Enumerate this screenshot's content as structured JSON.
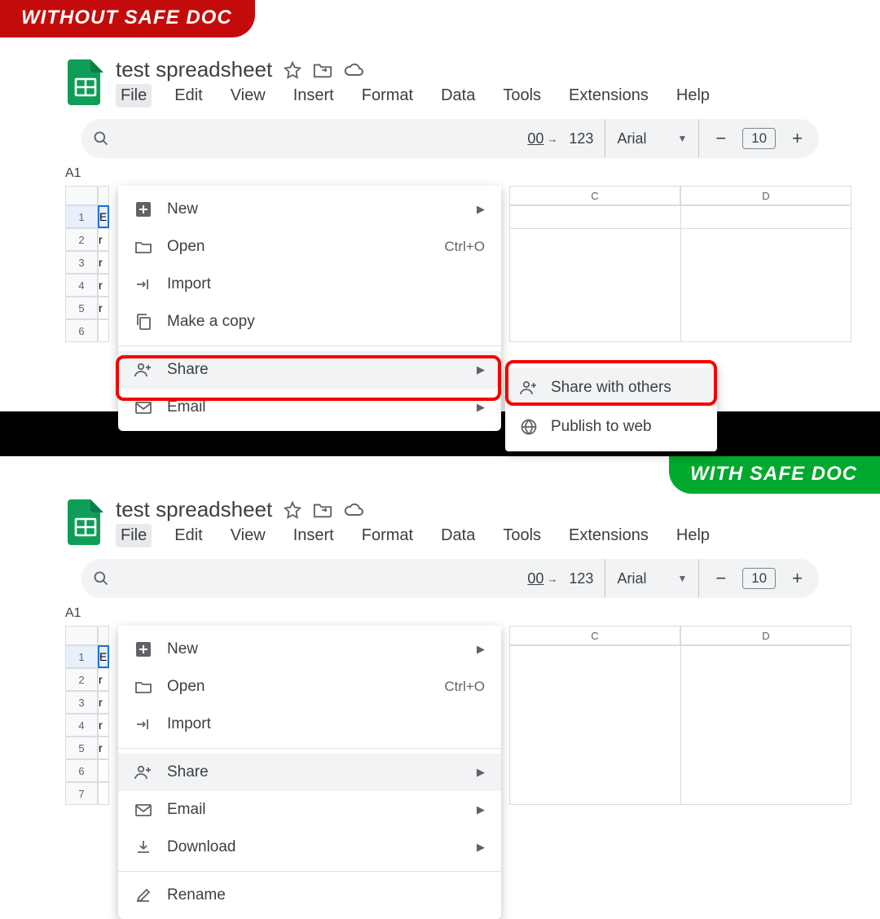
{
  "badges": {
    "without": "WITHOUT SAFE DOC",
    "with": "WITH SAFE DOC"
  },
  "doc": {
    "title": "test spreadsheet"
  },
  "menubar": [
    "File",
    "Edit",
    "View",
    "Insert",
    "Format",
    "Data",
    "Tools",
    "Extensions",
    "Help"
  ],
  "toolbar": {
    "zero_inc": "00",
    "num_fmt": "123",
    "font": "Arial",
    "size": "10"
  },
  "cell_ref": "A1",
  "cols": {
    "c": "C",
    "d": "D"
  },
  "rows": [
    "1",
    "2",
    "3",
    "4",
    "5",
    "6",
    "7"
  ],
  "cell_trunc": {
    "b": "E",
    "r": "r"
  },
  "file_menu": {
    "new": "New",
    "open": "Open",
    "open_shortcut": "Ctrl+O",
    "import": "Import",
    "make_copy": "Make a copy",
    "share": "Share",
    "email": "Email",
    "download": "Download",
    "rename": "Rename"
  },
  "share_submenu": {
    "share_with_others": "Share with others",
    "publish": "Publish to web"
  }
}
